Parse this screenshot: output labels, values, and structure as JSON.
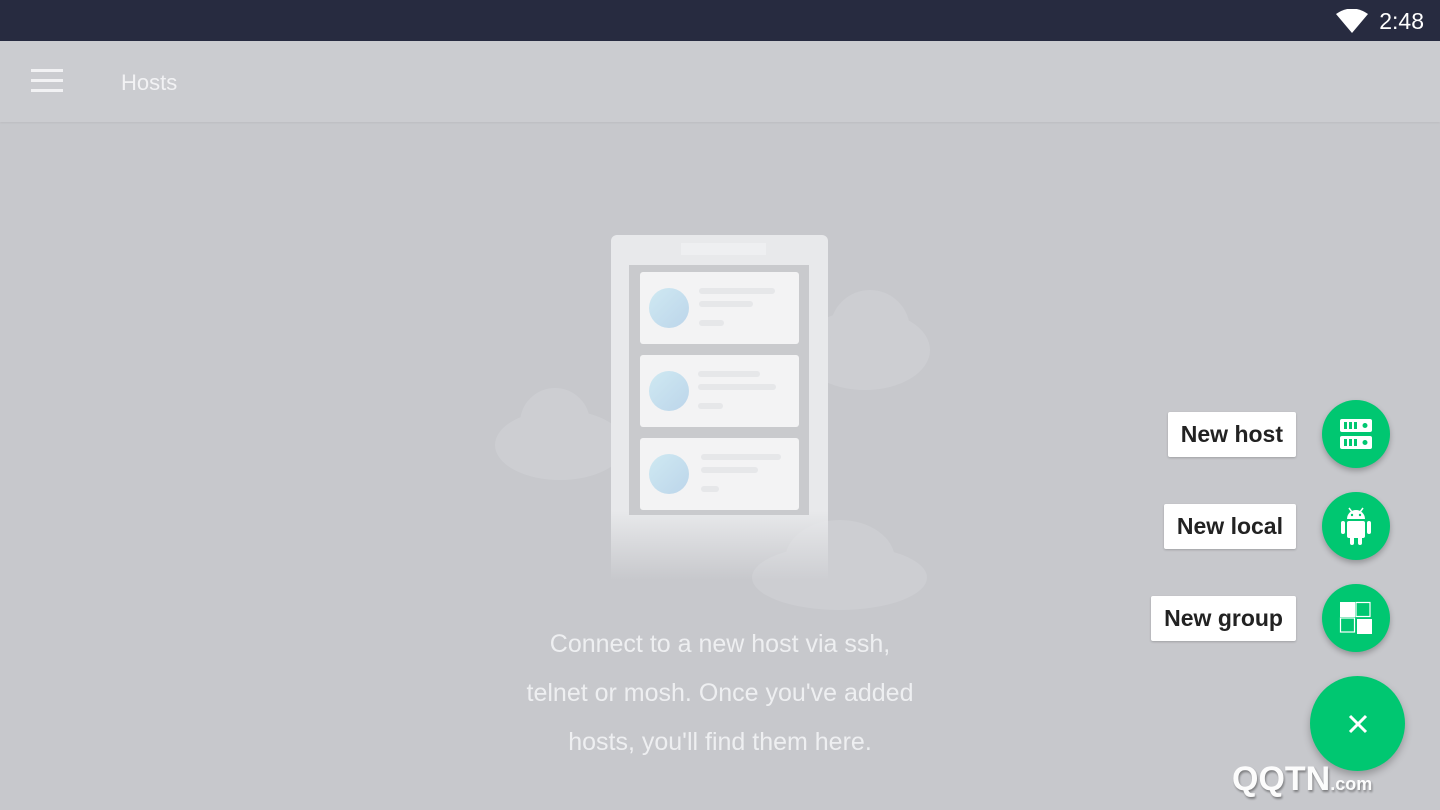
{
  "status_bar": {
    "time": "2:48",
    "wifi_icon": "wifi-icon"
  },
  "app_bar": {
    "title": "Hosts",
    "menu_icon": "hamburger-menu-icon"
  },
  "empty_state": {
    "lines": [
      "Connect to a new host via ssh,",
      "telnet or mosh. Once you've added",
      "hosts, you'll find them here."
    ]
  },
  "fab_menu": {
    "items": [
      {
        "label": "New host",
        "icon": "server-icon"
      },
      {
        "label": "New local",
        "icon": "android-icon"
      },
      {
        "label": "New group",
        "icon": "group-icon"
      }
    ],
    "close_icon": "close-icon",
    "accent": "#00c771"
  },
  "watermark": {
    "text": "QQTN",
    "suffix": ".com"
  }
}
